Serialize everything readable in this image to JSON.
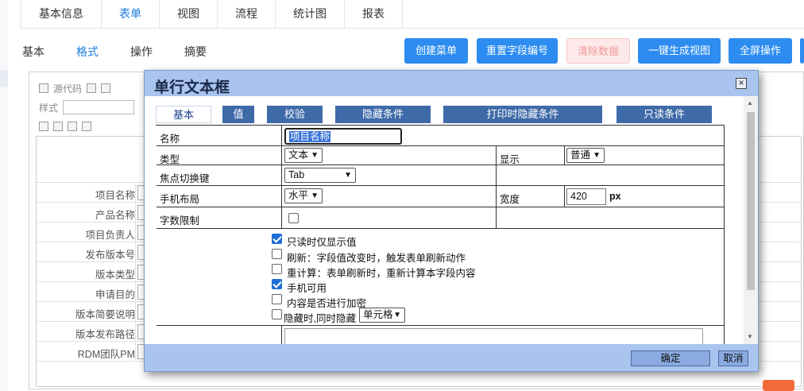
{
  "top_tabs": [
    "基本信息",
    "表单",
    "视图",
    "流程",
    "统计图",
    "报表"
  ],
  "top_tab_active": "表单",
  "sub_tabs": [
    "基本",
    "格式",
    "操作",
    "摘要"
  ],
  "sub_tab_active": "格式",
  "actions": {
    "create_menu": "创建菜单",
    "reset_field_no": "重置字段编号",
    "clear_data": "清除数据",
    "generate_view": "一键生成视图",
    "fullscreen": "全屏操作"
  },
  "editor_toolbar": {
    "source": "源代码",
    "style_label": "样式"
  },
  "form_fields": [
    "项目名称",
    "产品名称",
    "项目负责人",
    "发布版本号",
    "版本类型",
    "申请目的",
    "版本简要说明",
    "版本发布路径",
    "RDM团队PM"
  ],
  "dialog": {
    "title": "单行文本框",
    "close": "×",
    "tabs": [
      "基本",
      "值",
      "校验",
      "隐藏条件",
      "打印时隐藏条件",
      "只读条件"
    ],
    "labels": {
      "name": "名称",
      "type": "类型",
      "display": "显示",
      "focus_key": "焦点切换键",
      "mobile_layout": "手机布局",
      "width": "宽度",
      "char_limit": "字数限制"
    },
    "values": {
      "name": "项目名称",
      "type": "文本",
      "display": "普通",
      "focus_key": "Tab",
      "mobile_layout": "水平",
      "width": "420",
      "width_unit": "px"
    },
    "options": [
      {
        "label": "只读时仅显示值",
        "checked": true
      },
      {
        "label": "刷新：字段值改变时，触发表单刷新动作",
        "checked": false
      },
      {
        "label": "重计算：表单刷新时，重新计算本字段内容",
        "checked": false
      },
      {
        "label": "手机可用",
        "checked": true
      },
      {
        "label": "内容是否进行加密",
        "checked": false
      },
      {
        "label": "隐藏时,同时隐藏",
        "checked": false
      }
    ],
    "hide_with": "单元格",
    "ok": "确定",
    "cancel": "取消"
  },
  "colors": {
    "primary": "#2d8cf0",
    "dialog_title": "#a9c4ee",
    "dialog_tab": "#3f6aa8"
  }
}
